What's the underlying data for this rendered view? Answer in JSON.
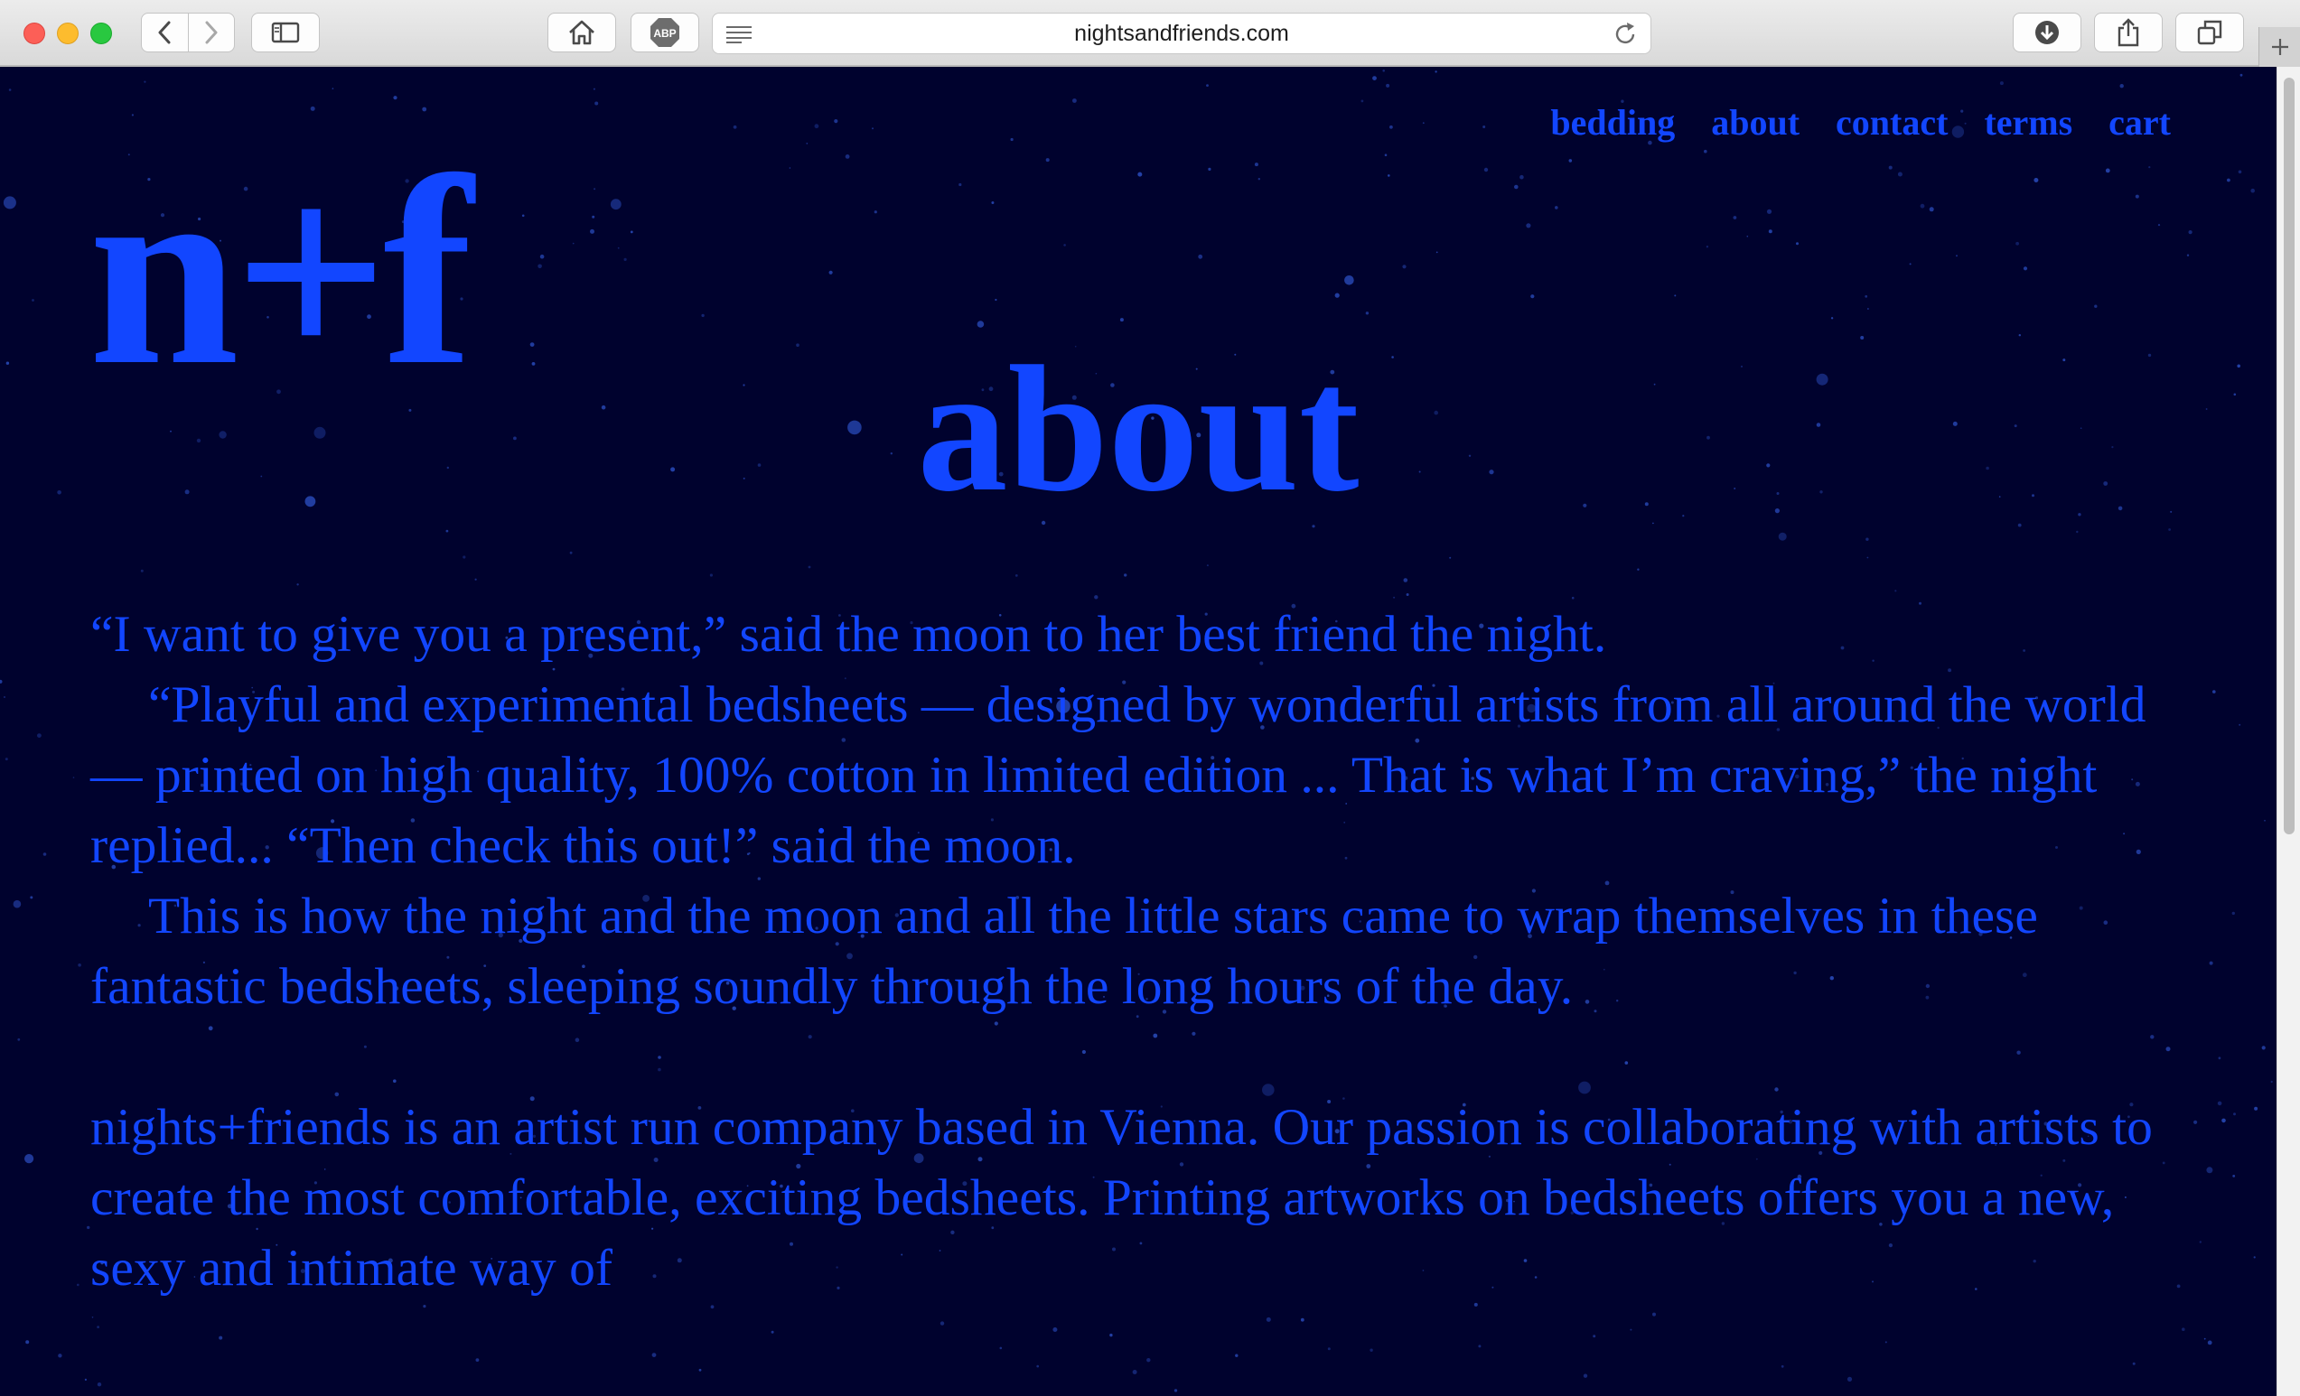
{
  "browser": {
    "url": "nightsandfriends.com",
    "icons": [
      "back-icon",
      "forward-icon",
      "sidebar-icon",
      "home-icon",
      "adblock-icon",
      "reader-icon",
      "reload-icon",
      "downloads-icon",
      "share-icon",
      "tabs-icon",
      "new-tab-icon"
    ],
    "adblock_label": "ABP"
  },
  "site": {
    "logo": "n+f",
    "nav": [
      "bedding",
      "about",
      "contact",
      "terms",
      "cart"
    ],
    "page_title": "about",
    "paragraphs": [
      "“I want to give you a present,” said the moon to her best friend the night.",
      "“Playful and experimental bedsheets — designed by wonderful artists from all around the world — printed on high quality, 100% cotton in limited edition ... That is what I’m craving,” the night replied... “Then check this out!” said the moon.",
      "This is how the night and the moon and all the little stars came to wrap themselves in these fantastic bedsheets, sleeping soundly through the long hours of the day.",
      "nights+friends is an artist run company based in Vienna. Our passion is collaborating with artists to create the most comfortable, exciting bedsheets. Printing artworks on bedsheets offers you a new, sexy and intimate way of"
    ]
  },
  "colors": {
    "background": "#00022e",
    "accent": "#1246ff"
  }
}
